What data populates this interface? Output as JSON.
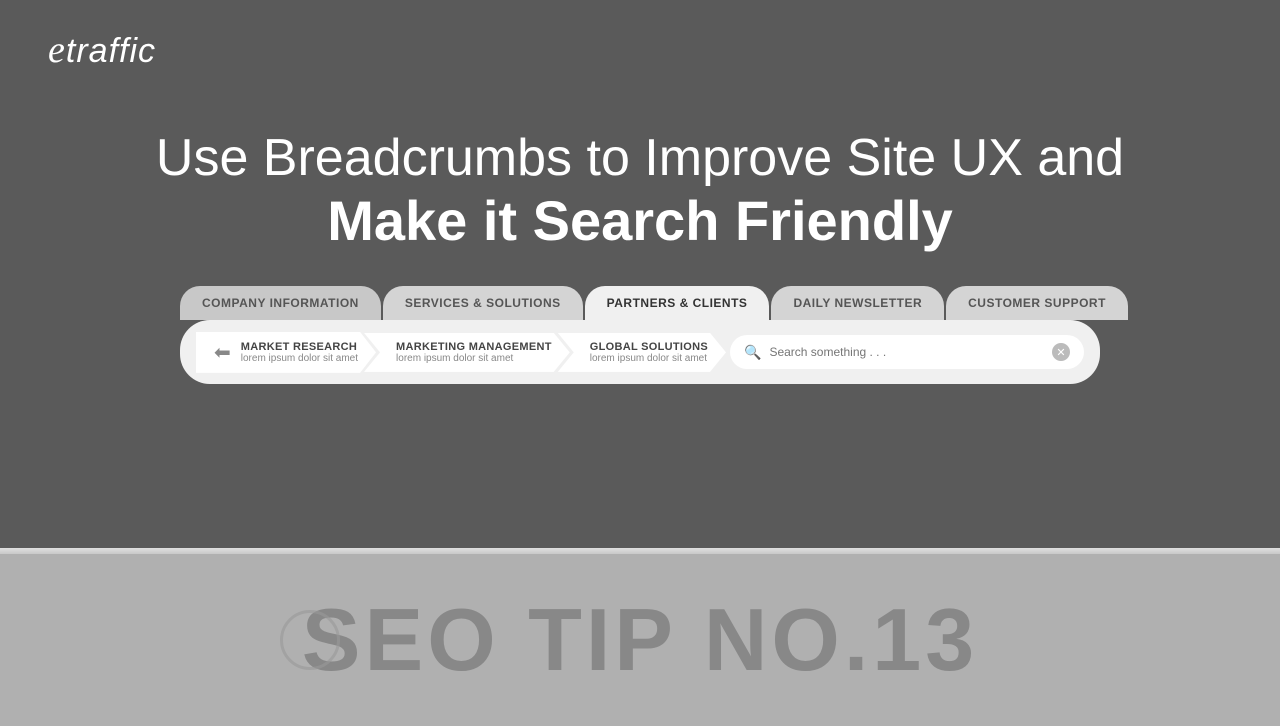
{
  "logo": {
    "text": "etraffic"
  },
  "headline": {
    "line1": "Use Breadcrumbs to Improve Site UX and",
    "line2": "Make it Search Friendly"
  },
  "tabs": [
    {
      "id": "company-info",
      "label": "COMPANY INFORMATION",
      "active": false
    },
    {
      "id": "services",
      "label": "SERVICES & SOLUTIONS",
      "active": false
    },
    {
      "id": "partners",
      "label": "PARTNERS & CLIENTS",
      "active": true
    },
    {
      "id": "newsletter",
      "label": "DAILY NEWSLETTER",
      "active": false
    },
    {
      "id": "support",
      "label": "CUSTOMER SUPPORT",
      "active": false
    }
  ],
  "breadcrumbs": [
    {
      "id": "market-research",
      "icon": "⬅",
      "title": "MARKET RESEARCH",
      "subtitle": "lorem ipsum dolor sit amet"
    },
    {
      "id": "marketing-management",
      "icon": null,
      "title": "MARKETING MANAGEMENT",
      "subtitle": "lorem ipsum dolor sit amet"
    },
    {
      "id": "global-solutions",
      "icon": null,
      "title": "GLOBAL SOLUTIONS",
      "subtitle": "lorem ipsum dolor sit amet"
    }
  ],
  "search": {
    "placeholder": "Search something . . ."
  },
  "seo_tip": {
    "text": "SEO TIP NO.13"
  }
}
